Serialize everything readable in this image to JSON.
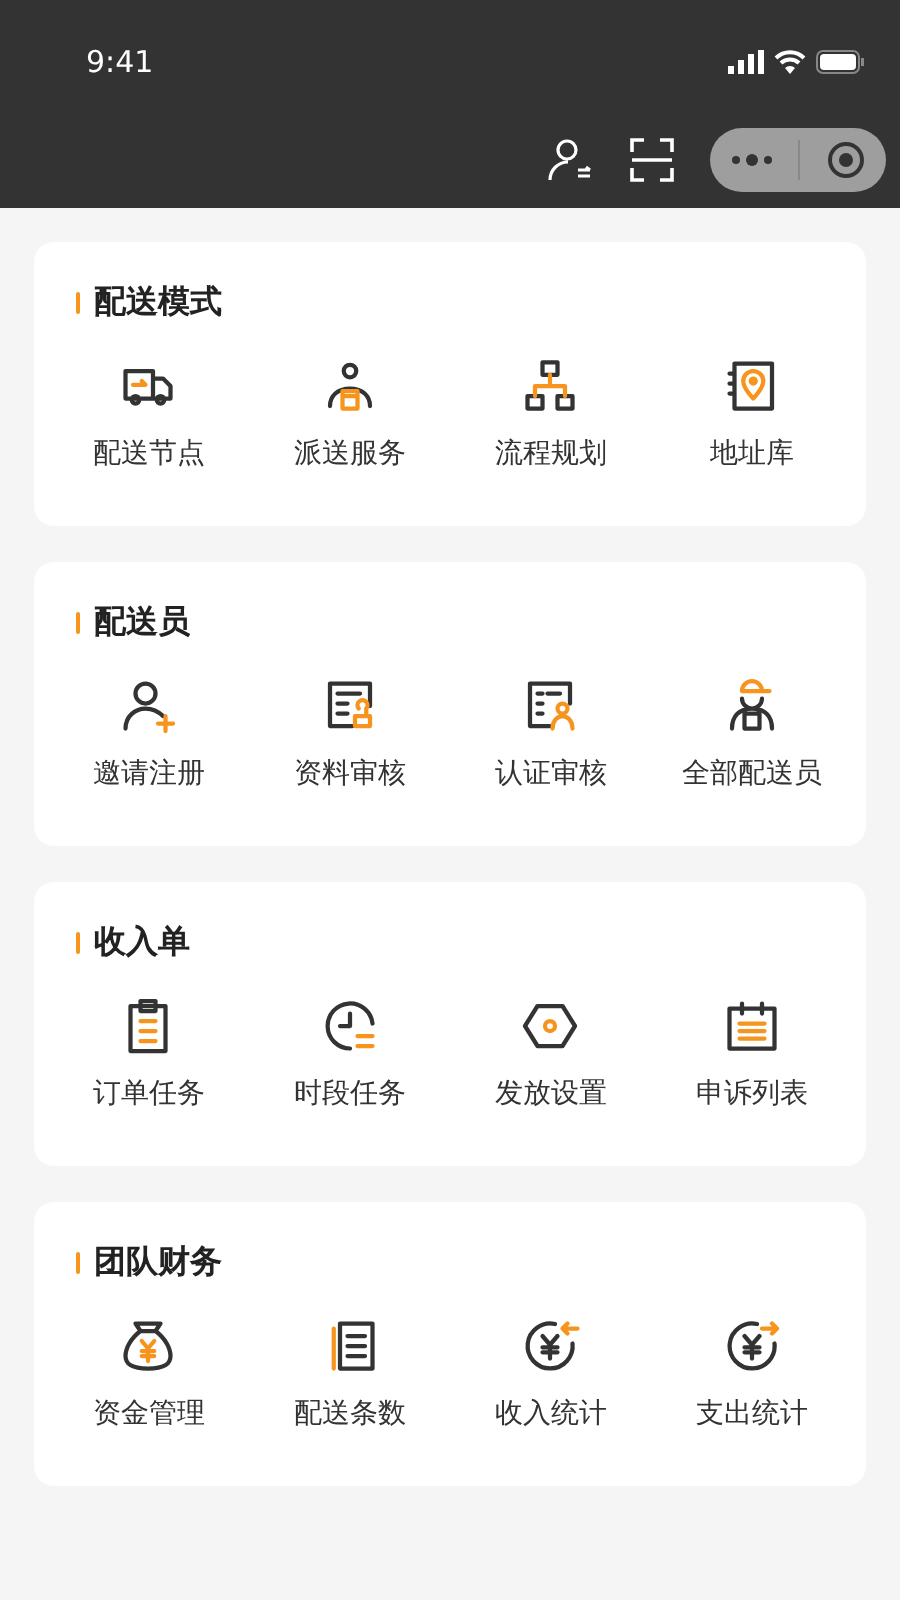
{
  "status_bar": {
    "time": "9:41"
  },
  "sections": [
    {
      "title": "配送模式",
      "items": [
        {
          "label": "配送节点",
          "kind": "truck"
        },
        {
          "label": "派送服务",
          "kind": "courier"
        },
        {
          "label": "流程规划",
          "kind": "flowchart"
        },
        {
          "label": "地址库",
          "kind": "address-book"
        }
      ]
    },
    {
      "title": "配送员",
      "items": [
        {
          "label": "邀请注册",
          "kind": "user-add"
        },
        {
          "label": "资料审核",
          "kind": "document-stamp"
        },
        {
          "label": "认证审核",
          "kind": "document-user"
        },
        {
          "label": "全部配送员",
          "kind": "rider"
        }
      ]
    },
    {
      "title": "收入单",
      "items": [
        {
          "label": "订单任务",
          "kind": "clipboard"
        },
        {
          "label": "时段任务",
          "kind": "clock"
        },
        {
          "label": "发放设置",
          "kind": "hexagon"
        },
        {
          "label": "申诉列表",
          "kind": "calendar"
        }
      ]
    },
    {
      "title": "团队财务",
      "items": [
        {
          "label": "资金管理",
          "kind": "money-bag"
        },
        {
          "label": "配送条数",
          "kind": "list-document"
        },
        {
          "label": "收入统计",
          "kind": "income"
        },
        {
          "label": "支出统计",
          "kind": "expense"
        }
      ]
    }
  ]
}
